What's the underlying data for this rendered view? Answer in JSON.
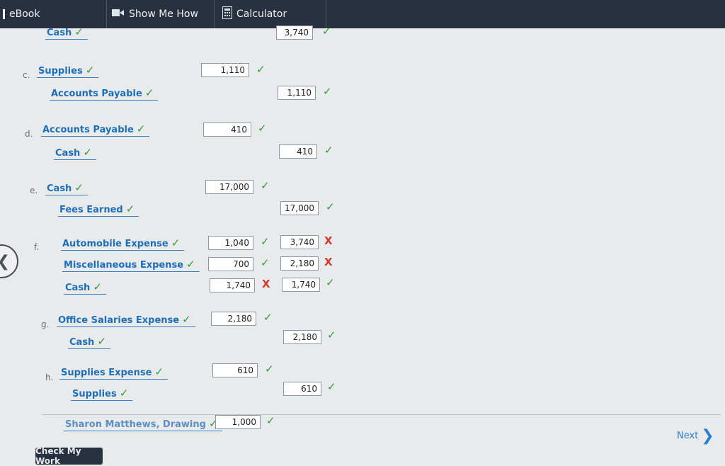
{
  "toolbar": {
    "ebook": "eBook",
    "show_me_how": "Show Me How",
    "calculator": "Calculator"
  },
  "entries": {
    "b": {
      "letter": "",
      "credit_account": "Cash",
      "credit_amount": "3,740"
    },
    "c": {
      "letter": "c.",
      "debit_account": "Supplies",
      "debit_amount": "1,110",
      "credit_account": "Accounts Payable",
      "credit_amount": "1,110"
    },
    "d": {
      "letter": "d.",
      "debit_account": "Accounts Payable",
      "debit_amount": "410",
      "credit_account": "Cash",
      "credit_amount": "410"
    },
    "e": {
      "letter": "e.",
      "debit_account": "Cash",
      "debit_amount": "17,000",
      "credit_account": "Fees Earned",
      "credit_amount": "17,000"
    },
    "f": {
      "letter": "f.",
      "line1_account": "Automobile Expense",
      "line1_debit": "1,040",
      "line1_credit": "3,740",
      "line2_account": "Miscellaneous Expense",
      "line2_debit": "700",
      "line2_credit": "2,180",
      "line3_account": "Cash",
      "line3_debit": "1,740",
      "line3_credit": "1,740"
    },
    "g": {
      "letter": "g.",
      "debit_account": "Office Salaries Expense",
      "debit_amount": "2,180",
      "credit_account": "Cash",
      "credit_amount": "2,180"
    },
    "h": {
      "letter": "h.",
      "debit_account": "Supplies Expense",
      "debit_amount": "610",
      "credit_account": "Supplies",
      "credit_amount": "610"
    },
    "i": {
      "letter": "i.",
      "debit_account": "Sharon Matthews, Drawing",
      "debit_amount": "1,000"
    }
  },
  "marks": {
    "check": "✓",
    "cross": "X"
  },
  "buttons": {
    "check_my_work": "Check My Work",
    "next": "Next"
  }
}
